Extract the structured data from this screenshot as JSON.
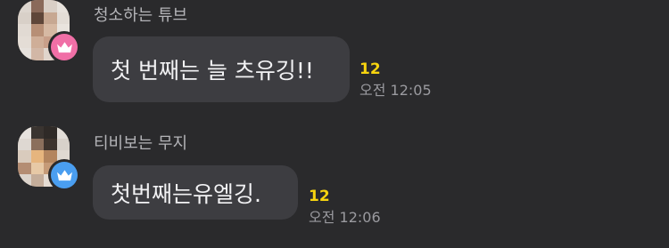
{
  "messages": [
    {
      "sender": "청소하는 튜브",
      "text": "첫 번째는 늘 츠유깅!!",
      "unread_count": "12",
      "time": "오전 12:05",
      "badge_icon": "crown-icon",
      "badge_color": "#f06fa6"
    },
    {
      "sender": "티비보는 무지",
      "text": "첫번째는유엘깅.",
      "unread_count": "12",
      "time": "오전 12:06",
      "badge_icon": "crown-icon",
      "badge_color": "#4a9ef0"
    }
  ],
  "colors": {
    "background": "#2a2a2c",
    "bubble": "#3d3d41",
    "unread": "#f7d40f",
    "time": "#9a9a9f",
    "sender": "#b4b4b8"
  }
}
